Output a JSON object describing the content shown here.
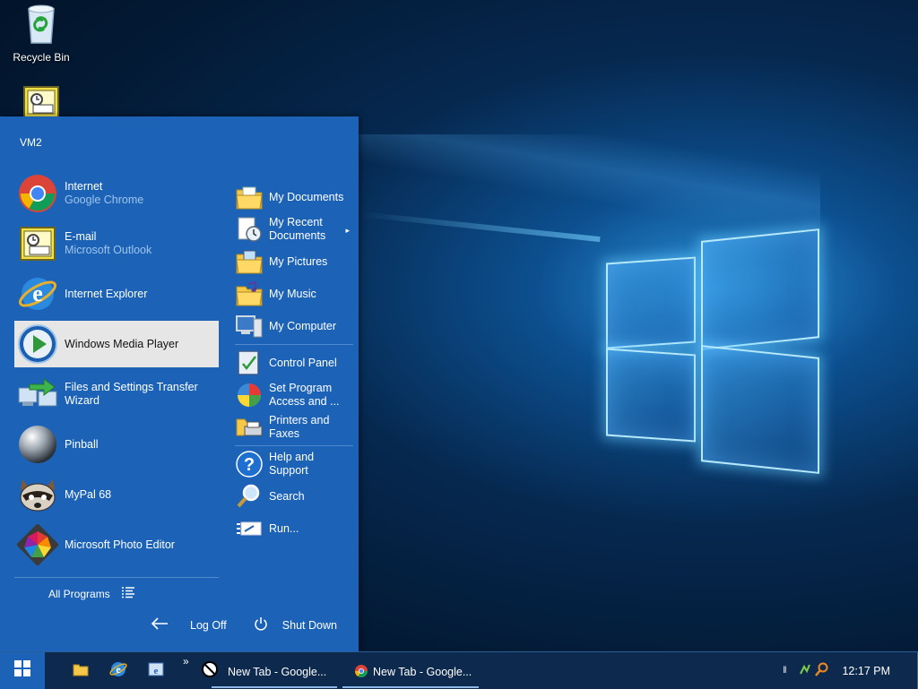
{
  "desktop": {
    "icons": [
      {
        "label": "Recycle Bin",
        "icon": "recycle-bin-icon"
      },
      {
        "label": "",
        "icon": "outlook-icon"
      }
    ]
  },
  "start_menu": {
    "user": "VM2",
    "pinned": [
      {
        "title": "Internet",
        "subtitle": "Google Chrome",
        "icon": "chrome-icon"
      },
      {
        "title": "E-mail",
        "subtitle": "Microsoft Outlook",
        "icon": "outlook-icon"
      }
    ],
    "recent": [
      {
        "title": "Internet Explorer",
        "icon": "internet-explorer-icon"
      },
      {
        "title": "Windows Media Player",
        "icon": "windows-media-player-icon",
        "selected": true
      },
      {
        "title": "Files and Settings Transfer Wizard",
        "icon": "transfer-wizard-icon"
      },
      {
        "title": "Pinball",
        "icon": "pinball-icon"
      },
      {
        "title": "MyPal 68",
        "icon": "mypal-icon"
      },
      {
        "title": "Microsoft Photo Editor",
        "icon": "photo-editor-icon"
      }
    ],
    "all_programs": "All Programs",
    "places": [
      {
        "label": "My Documents",
        "icon": "my-documents-icon"
      },
      {
        "label": "My Recent Documents",
        "icon": "recent-documents-icon",
        "has_submenu": true
      },
      {
        "label": "My Pictures",
        "icon": "my-pictures-icon"
      },
      {
        "label": "My Music",
        "icon": "my-music-icon"
      },
      {
        "label": "My Computer",
        "icon": "my-computer-icon"
      }
    ],
    "system": [
      {
        "label": "Control Panel",
        "icon": "control-panel-icon"
      },
      {
        "label": "Set Program Access and ...",
        "icon": "set-program-access-icon"
      },
      {
        "label": "Printers and Faxes",
        "icon": "printers-icon"
      }
    ],
    "help": [
      {
        "label": "Help and Support",
        "icon": "help-icon"
      },
      {
        "label": "Search",
        "icon": "search-icon"
      },
      {
        "label": "Run...",
        "icon": "run-icon"
      }
    ],
    "log_off": "Log Off",
    "shut_down": "Shut Down",
    "submenu_arrow": "▸"
  },
  "taskbar": {
    "ql_chevron": "»",
    "buttons": [
      {
        "label": "New Tab - Google...",
        "icon": "chrome-icon"
      },
      {
        "label": "New Tab - Google...",
        "icon": "chrome-icon"
      }
    ],
    "clock": "12:17 PM"
  },
  "colors": {
    "accent": "#1c63b7",
    "taskbar": "#0d2a4e",
    "selected": "#e6e6e6"
  }
}
